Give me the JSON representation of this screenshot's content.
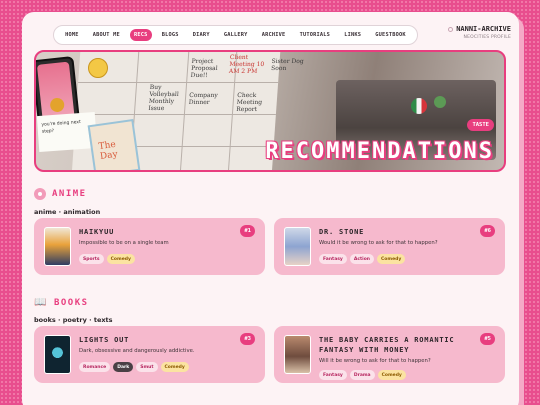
{
  "nav": {
    "items": [
      "HOME",
      "ABOUT ME",
      "RECS",
      "BLOGS",
      "DIARY",
      "GALLERY",
      "ARCHIVE",
      "TUTORIALS",
      "LINKS",
      "GUESTBOOK"
    ],
    "active": "RECS"
  },
  "brand": {
    "title": "NANNI-ARCHIVE",
    "subtitle": "NEOCITIES PROFILE"
  },
  "banner": {
    "title": "RECOMMENDATIONS",
    "tag": "TASTE",
    "notes": [
      "Client Meeting 10 AM 2 PM",
      "Project Proposal Due!!",
      "Sister Dog Soon",
      "Buy Volleyball Monthly Issue",
      "Company Dinner",
      "Check Meeting Report",
      "The Day"
    ],
    "sticky": "you're doing next step?"
  },
  "sections": [
    {
      "title": "ANIME",
      "subtitle": "anime · animation",
      "cards": [
        {
          "title": "HAIKYUU",
          "desc": "Impossible to be on a single team",
          "rank": "#1",
          "tags": [
            "Sports",
            "Comedy"
          ]
        },
        {
          "title": "DR. STONE",
          "desc": "Would it be wrong to ask for that to happen?",
          "rank": "#6",
          "tags": [
            "Fantasy",
            "Action",
            "Comedy"
          ]
        }
      ]
    },
    {
      "title": "BOOKS",
      "subtitle": "books · poetry · texts",
      "cards": [
        {
          "title": "LIGHTS OUT",
          "desc": "Dark, obsessive and dangerously addictive.",
          "rank": "#3",
          "tags": [
            "Romance",
            "Dark",
            "Smut",
            "Comedy"
          ]
        },
        {
          "title": "THE BABY CARRIES A ROMANTIC FANTASY WITH MONEY",
          "desc": "Will it be wrong to ask for that to happen?",
          "rank": "#5",
          "tags": [
            "Fantasy",
            "Drama",
            "Comedy"
          ]
        }
      ]
    }
  ],
  "colors": {
    "accent": "#e83e7f",
    "card": "#f6b9cd",
    "page": "#fdf3f5",
    "background": "#e84e8e"
  }
}
